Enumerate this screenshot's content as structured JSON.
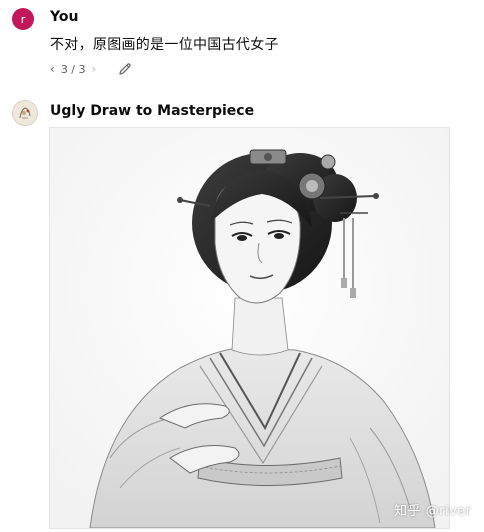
{
  "user_message": {
    "avatar_letter": "r",
    "avatar_color": "#c2185b",
    "author": "You",
    "text": "不对，原图画的是一位中国古代女子",
    "pager": {
      "current": 3,
      "total": 3,
      "label": "3 / 3"
    }
  },
  "assistant_message": {
    "author": "Ugly Draw to Masterpiece",
    "image_icon": "generated-portrait-image"
  },
  "watermark": "知乎 @river"
}
